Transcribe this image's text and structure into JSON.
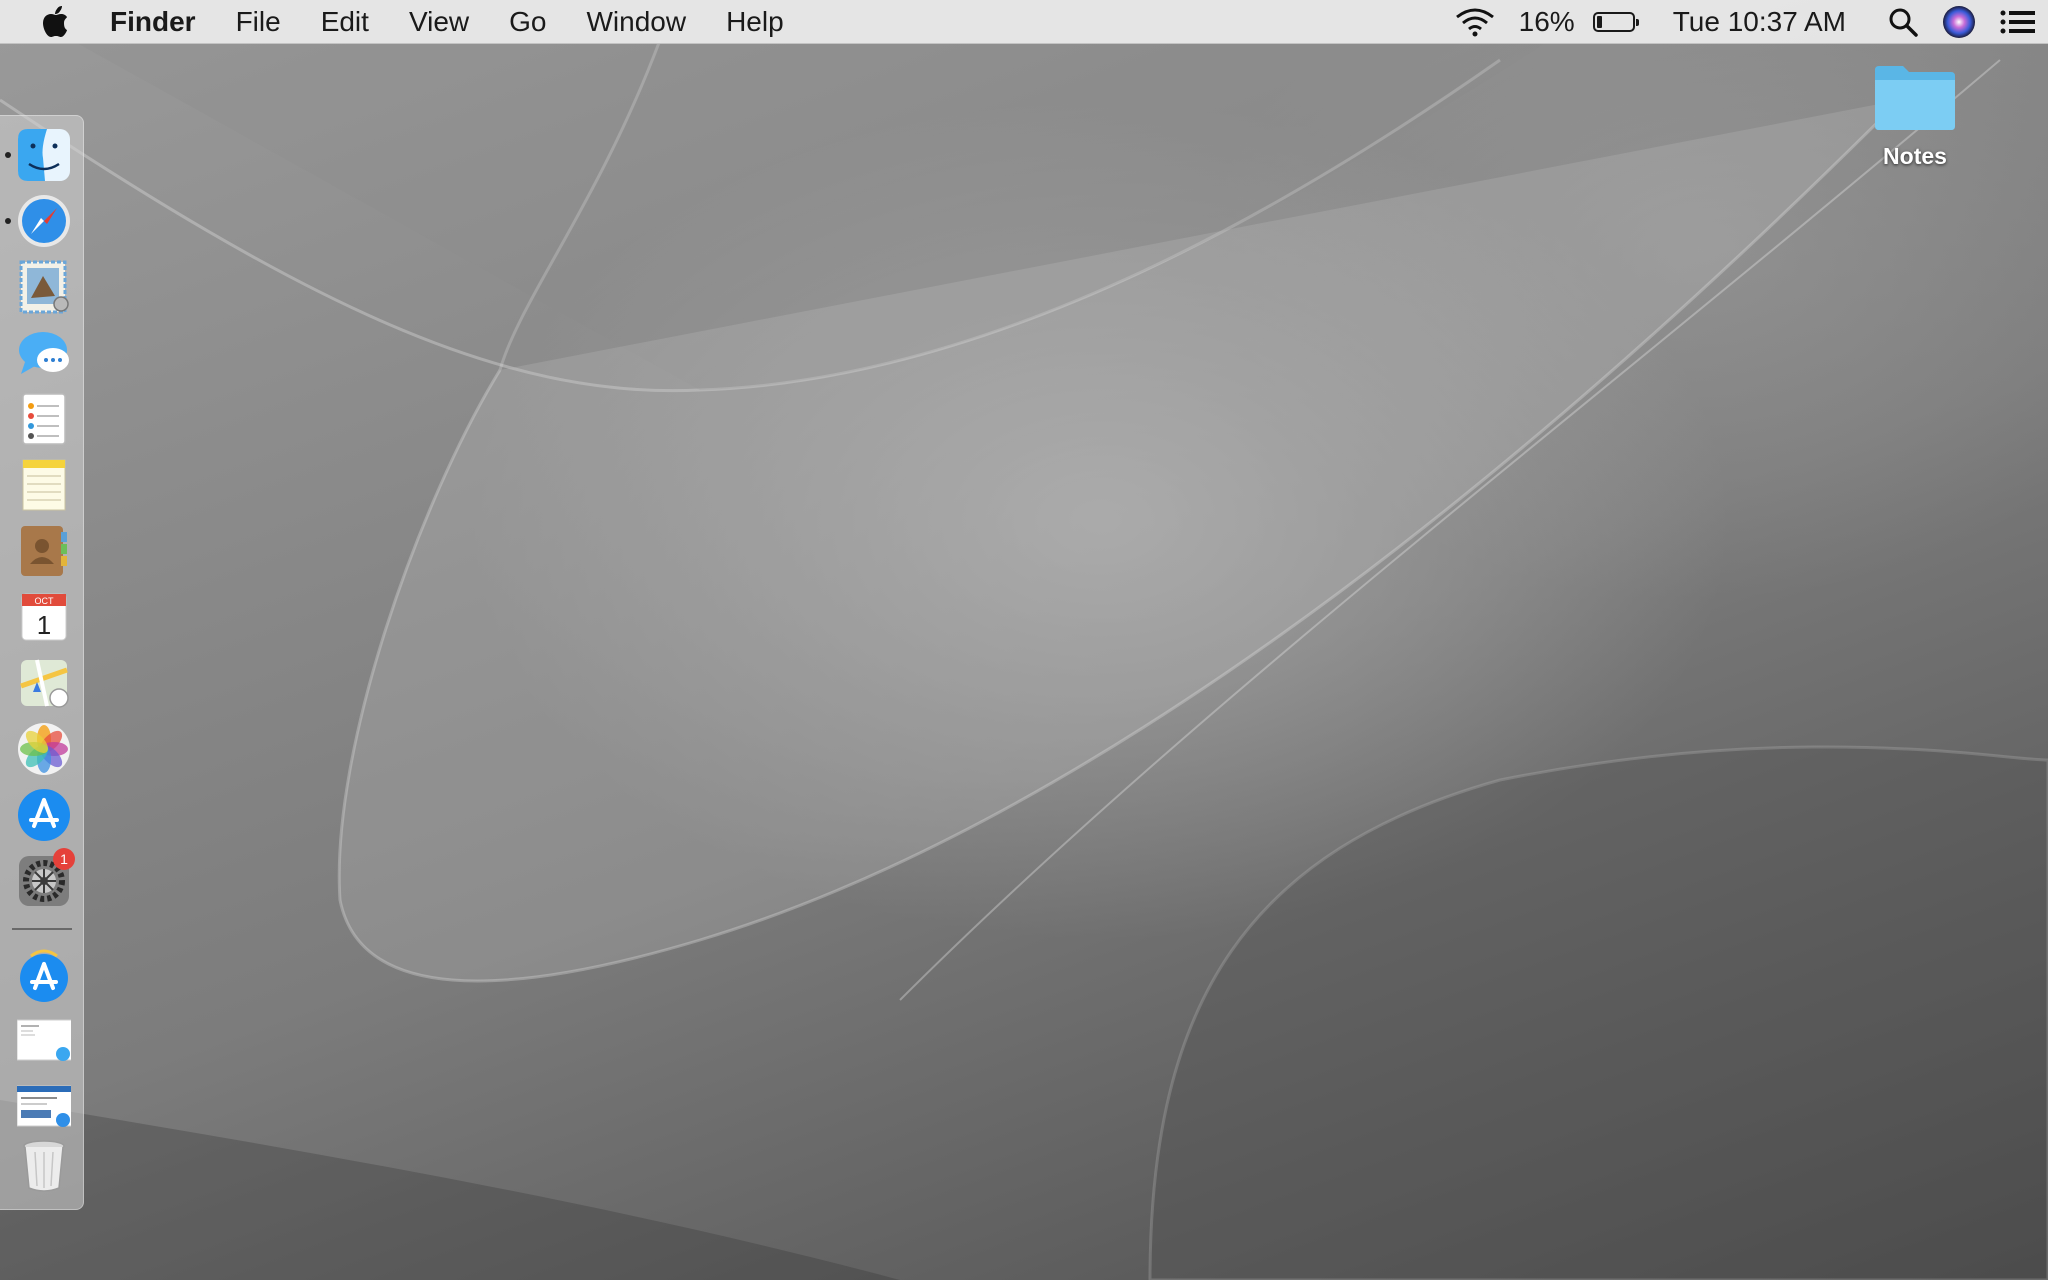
{
  "menubar": {
    "apple_icon": "apple-logo",
    "app_name": "Finder",
    "menus": [
      "File",
      "Edit",
      "View",
      "Go",
      "Window",
      "Help"
    ],
    "status": {
      "wifi_icon": "wifi-icon",
      "battery_percent": "16%",
      "battery_level": 0.16,
      "clock": "Tue 10:37 AM",
      "search_icon": "spotlight-search-icon",
      "siri_icon": "siri-icon",
      "notifications_icon": "notification-center-icon"
    }
  },
  "desktop": {
    "icons": [
      {
        "label": "Notes",
        "icon": "folder-icon",
        "color": "#6cc4ee"
      }
    ]
  },
  "dock": {
    "apps": [
      {
        "name": "Finder",
        "icon": "finder-icon",
        "running": true
      },
      {
        "name": "Safari",
        "icon": "safari-icon",
        "running": true
      },
      {
        "name": "Mail",
        "icon": "mail-icon",
        "running": false
      },
      {
        "name": "Messages",
        "icon": "messages-icon",
        "running": false
      },
      {
        "name": "Reminders",
        "icon": "reminders-icon",
        "running": false
      },
      {
        "name": "Notes",
        "icon": "notes-icon",
        "running": false
      },
      {
        "name": "Contacts",
        "icon": "contacts-icon",
        "running": false
      },
      {
        "name": "Calendar",
        "icon": "calendar-icon",
        "running": false,
        "month": "OCT",
        "day": "1"
      },
      {
        "name": "Maps",
        "icon": "maps-icon",
        "running": false
      },
      {
        "name": "Photos",
        "icon": "photos-icon",
        "running": false
      },
      {
        "name": "App Store",
        "icon": "app-store-icon",
        "running": false
      },
      {
        "name": "System Preferences",
        "icon": "system-preferences-icon",
        "running": false,
        "badge": "1"
      }
    ],
    "stacks": [
      {
        "name": "Downloads",
        "icon": "app-store-download-icon"
      },
      {
        "name": "Document",
        "icon": "document-preview-icon"
      },
      {
        "name": "Web Page",
        "icon": "webpage-preview-icon"
      },
      {
        "name": "Trash",
        "icon": "trash-icon"
      }
    ]
  }
}
